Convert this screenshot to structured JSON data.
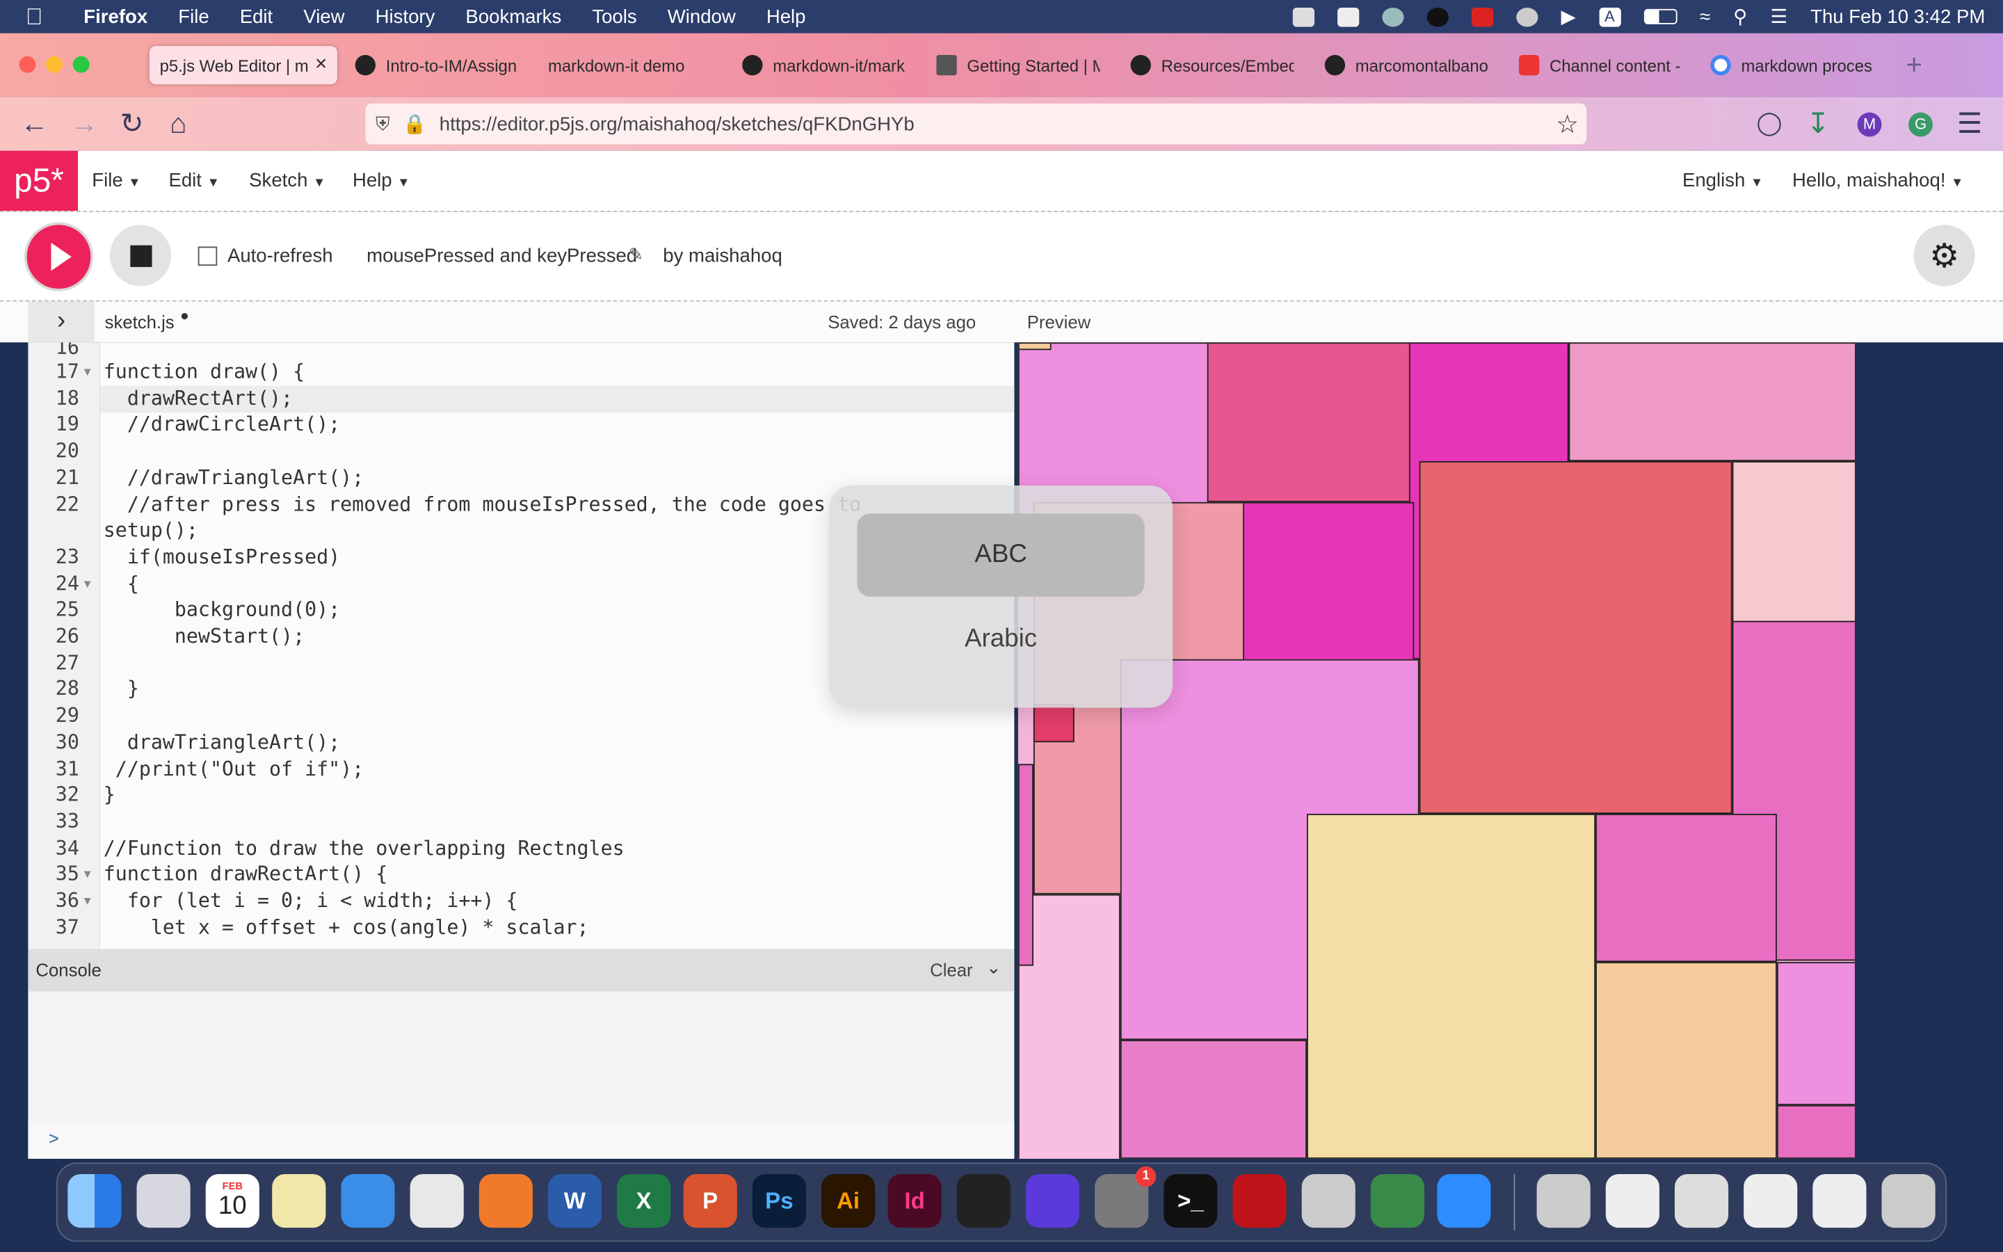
{
  "menubar": {
    "app_name": "Firefox",
    "items": [
      "File",
      "Edit",
      "View",
      "History",
      "Bookmarks",
      "Tools",
      "Window",
      "Help"
    ],
    "clock": "Thu Feb 10  3:42 PM",
    "status_letter": "A"
  },
  "tabs": [
    {
      "title": "p5.js Web Editor | m",
      "active": true,
      "close": "×"
    },
    {
      "title": "Intro-to-IM/Assign",
      "active": false
    },
    {
      "title": "markdown-it demo",
      "active": false
    },
    {
      "title": "markdown-it/mark",
      "active": false
    },
    {
      "title": "Getting Started | M",
      "active": false
    },
    {
      "title": "Resources/Embed",
      "active": false
    },
    {
      "title": "marcomontalbano",
      "active": false
    },
    {
      "title": "Channel content -",
      "active": false
    },
    {
      "title": "markdown proces",
      "active": false
    }
  ],
  "nav": {
    "url": "https://editor.p5js.org/maishahoq/sketches/qFKDnGHYb",
    "profile_initial": "M",
    "ext_initial": "G"
  },
  "p5": {
    "logo": "p5*",
    "menu": [
      "File",
      "Edit",
      "Sketch",
      "Help"
    ],
    "language": "English",
    "greeting": "Hello, maishahoq!",
    "auto_refresh_label": "Auto-refresh",
    "sketch_name": "mousePressed and keyPressed",
    "by_line": "by maishahoq",
    "file_tab": "sketch.js",
    "saved": "Saved: 2 days ago",
    "preview_label": "Preview",
    "console_label": "Console",
    "clear_label": "Clear",
    "console_prompt": ">"
  },
  "code": {
    "partial_top_line": "16",
    "lines": [
      {
        "n": "17",
        "fold": true,
        "text": "function draw() {"
      },
      {
        "n": "18",
        "fold": false,
        "text": "  drawRectArt();"
      },
      {
        "n": "19",
        "fold": false,
        "text": "  //drawCircleArt();"
      },
      {
        "n": "20",
        "fold": false,
        "text": ""
      },
      {
        "n": "21",
        "fold": false,
        "text": "  //drawTriangleArt();"
      },
      {
        "n": "22",
        "fold": false,
        "text": "  //after press is removed from mouseIsPressed, the code goes to"
      },
      {
        "n": "",
        "fold": false,
        "text": "setup();"
      },
      {
        "n": "23",
        "fold": false,
        "text": "  if(mouseIsPressed)"
      },
      {
        "n": "24",
        "fold": true,
        "text": "  {"
      },
      {
        "n": "25",
        "fold": false,
        "text": "      background(0);"
      },
      {
        "n": "26",
        "fold": false,
        "text": "      newStart();"
      },
      {
        "n": "27",
        "fold": false,
        "text": ""
      },
      {
        "n": "28",
        "fold": false,
        "text": "  }"
      },
      {
        "n": "29",
        "fold": false,
        "text": ""
      },
      {
        "n": "30",
        "fold": false,
        "text": "  drawTriangleArt();"
      },
      {
        "n": "31",
        "fold": false,
        "text": " //print(\"Out of if\");"
      },
      {
        "n": "32",
        "fold": false,
        "text": "}"
      },
      {
        "n": "33",
        "fold": false,
        "text": ""
      },
      {
        "n": "34",
        "fold": false,
        "text": "//Function to draw the overlapping Rectngles"
      },
      {
        "n": "35",
        "fold": true,
        "text": "function drawRectArt() {"
      },
      {
        "n": "36",
        "fold": true,
        "text": "  for (let i = 0; i < width; i++) {"
      },
      {
        "n": "37",
        "fold": false,
        "text": "    let x = offset + cos(angle) * scalar;"
      }
    ]
  },
  "input_popup": {
    "options": [
      "ABC",
      "Arabic"
    ],
    "selected": "ABC"
  },
  "preview_colors": [
    "#ee8fdf",
    "#e8568f",
    "#e735b8",
    "#f09ac8",
    "#e8646c",
    "#f6c8cf",
    "#ef9aa6",
    "#e86ec2",
    "#f7c0e0",
    "#ea7fc9",
    "#f5dda6",
    "#f4cc9c",
    "#e33d6a"
  ],
  "dock": {
    "calendar_month": "FEB",
    "calendar_day": "10",
    "badge_count": "1",
    "apps": [
      "Finder",
      "Launchpad",
      "Calendar",
      "Notes",
      "Safari",
      "Chrome",
      "Firefox",
      "Word",
      "Excel",
      "PowerPoint",
      "Photoshop",
      "Illustrator",
      "InDesign",
      "Final Cut Pro",
      "Screen Recorder",
      "System Preferences",
      "Terminal",
      "Acrobat",
      "Printer",
      "Network",
      "Zoom",
      "Archive",
      "Document 1",
      "Document 2",
      "Document 3",
      "Document 4",
      "Trash"
    ],
    "labels": {
      "word": "W",
      "excel": "X",
      "ppt": "P",
      "ps": "Ps",
      "ai": "Ai",
      "id": "Id",
      "terminal": ">_"
    }
  }
}
